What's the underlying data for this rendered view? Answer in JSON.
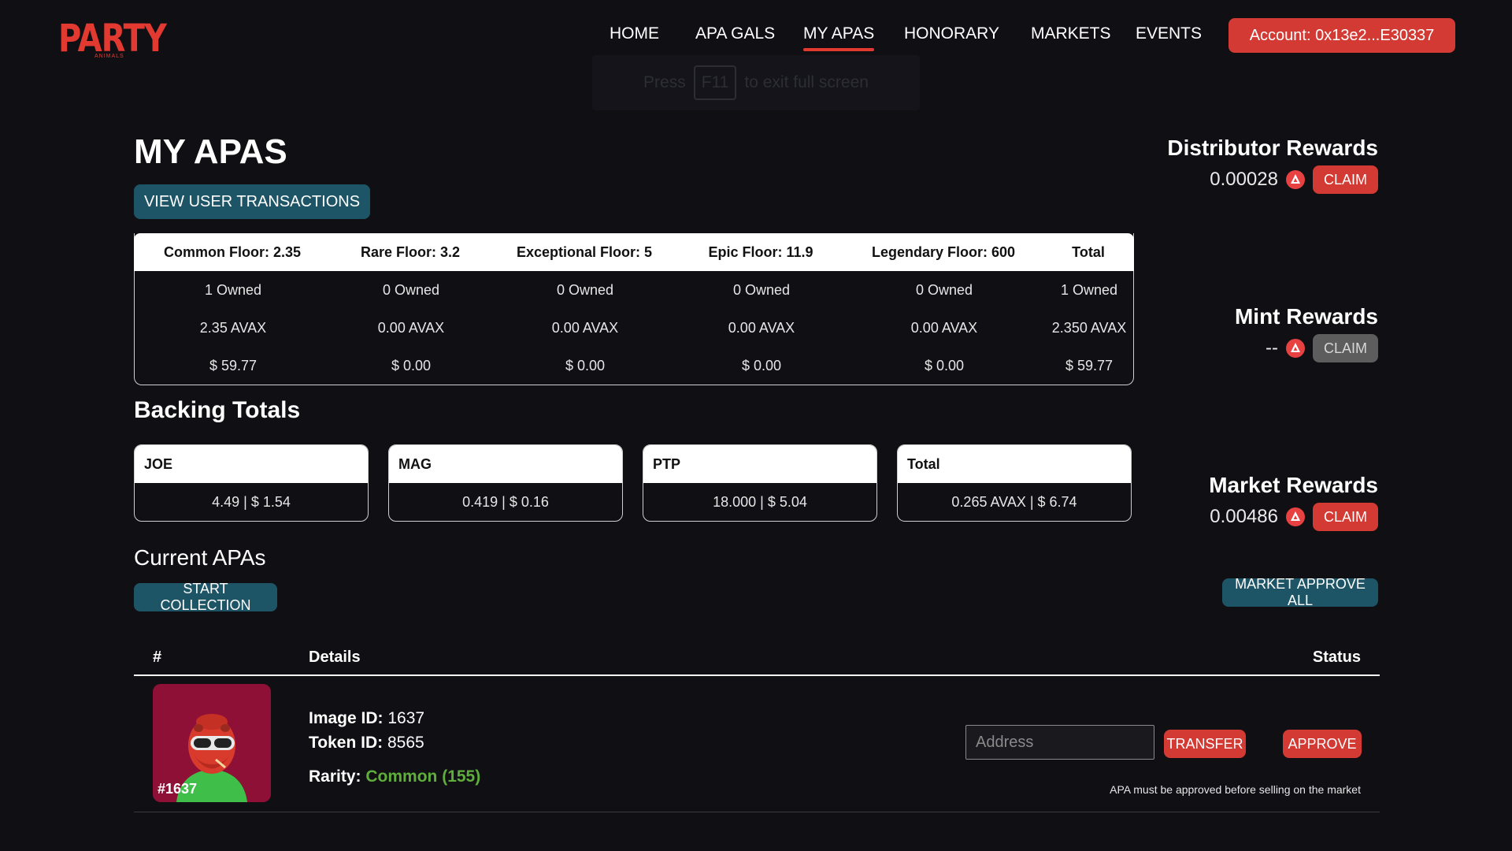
{
  "header": {
    "logo_text": "PARTY",
    "logo_sub": "ANIMALS",
    "nav": [
      {
        "label": "HOME",
        "active": false
      },
      {
        "label": "APA GALS",
        "active": false
      },
      {
        "label": "MY APAS",
        "active": true
      },
      {
        "label": "HONORARY",
        "active": false
      },
      {
        "label": "MARKETS",
        "active": false
      },
      {
        "label": "EVENTS",
        "active": false
      }
    ],
    "account_label": "Account: 0x13e2...E30337"
  },
  "fullscreen_notice": {
    "pre": "Press",
    "key": "F11",
    "post": "to exit full screen"
  },
  "main": {
    "title": "MY APAS",
    "view_tx_label": "VIEW USER TRANSACTIONS",
    "floor_table": {
      "headers": [
        "Common Floor: 2.35",
        "Rare Floor: 3.2",
        "Exceptional Floor: 5",
        "Epic Floor: 11.9",
        "Legendary Floor: 600",
        "Total"
      ],
      "rows": [
        [
          "1 Owned",
          "0 Owned",
          "0 Owned",
          "0 Owned",
          "0 Owned",
          "1 Owned"
        ],
        [
          "2.35 AVAX",
          "0.00 AVAX",
          "0.00 AVAX",
          "0.00 AVAX",
          "0.00 AVAX",
          "2.350 AVAX"
        ],
        [
          "$ 59.77",
          "$ 0.00",
          "$ 0.00",
          "$ 0.00",
          "$ 0.00",
          "$ 59.77"
        ]
      ]
    },
    "backing": {
      "title": "Backing Totals",
      "cards": [
        {
          "name": "JOE",
          "value": "4.49 | $ 1.54"
        },
        {
          "name": "MAG",
          "value": "0.419 | $ 0.16"
        },
        {
          "name": "PTP",
          "value": "18.000 | $ 5.04"
        },
        {
          "name": "Total",
          "value": "0.265 AVAX | $ 6.74"
        }
      ]
    },
    "current": {
      "title": "Current APAs",
      "start_label": "START COLLECTION",
      "columns": {
        "num": "#",
        "details": "Details",
        "status": "Status"
      },
      "items": [
        {
          "thumb_label": "#1637",
          "image_id_label": "Image ID:",
          "image_id": "1637",
          "token_id_label": "Token ID:",
          "token_id": "8565",
          "rarity_label": "Rarity:",
          "rarity": "Common (155)",
          "address_placeholder": "Address",
          "transfer_label": "TRANSFER",
          "approve_label": "APPROVE",
          "note": "APA must be approved before selling on the market"
        }
      ]
    }
  },
  "rewards": {
    "distributor": {
      "title": "Distributor Rewards",
      "value": "0.00028",
      "claim": "CLAIM"
    },
    "mint": {
      "title": "Mint Rewards",
      "value": "--",
      "claim": "CLAIM"
    },
    "market": {
      "title": "Market Rewards",
      "value": "0.00486",
      "claim": "CLAIM"
    },
    "approve_all_label": "MARKET APPROVE ALL"
  },
  "colors": {
    "brand_red": "#d33a33",
    "teal": "#1d5566",
    "rarity_common": "#5fae3c",
    "background": "#101014"
  }
}
